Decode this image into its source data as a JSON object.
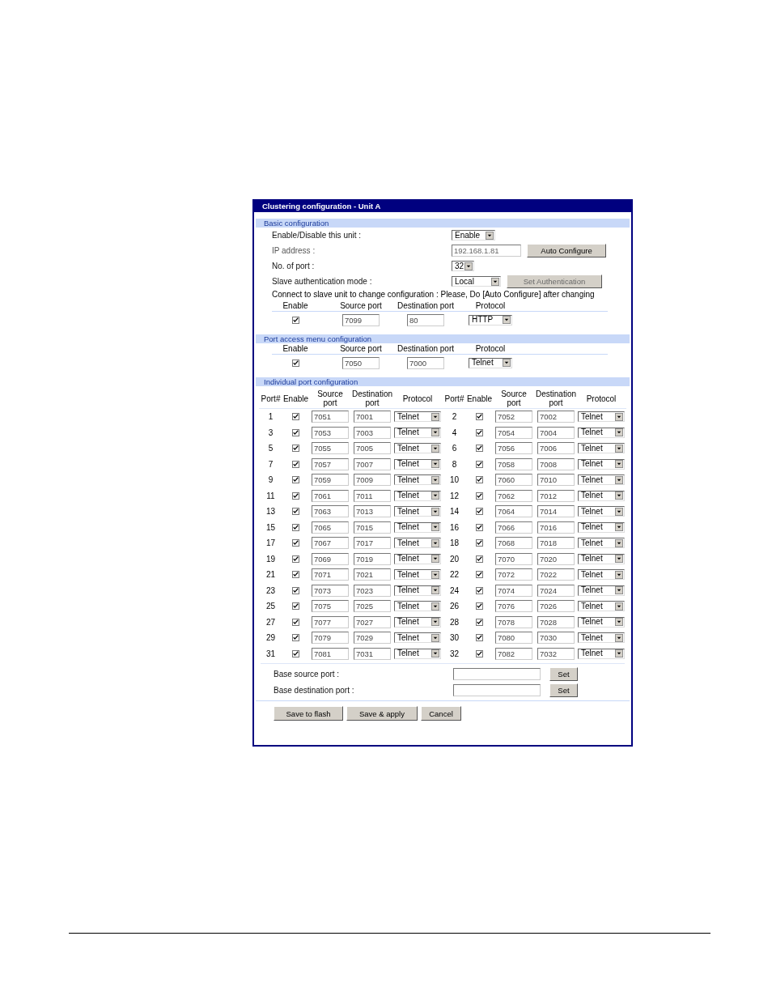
{
  "window": {
    "title": "Clustering configuration - Unit A"
  },
  "basic": {
    "heading": "Basic configuration",
    "fields": [
      {
        "label": "Enable/Disable this unit :",
        "kind": "select",
        "value": "Enable",
        "disabled": false
      },
      {
        "label": "IP address :",
        "kind": "input",
        "value": "192.168.1.81",
        "disabled": true,
        "button": {
          "label": "Auto Configure",
          "disabled": false
        }
      },
      {
        "label": "No. of port :",
        "kind": "select",
        "value": "32",
        "disabled": false
      },
      {
        "label": "Slave authentication mode :",
        "kind": "select",
        "value": "Local",
        "disabled": false,
        "button": {
          "label": "Set Authentication",
          "disabled": true
        }
      }
    ],
    "note": "Connect to slave unit to change configuration : Please, Do [Auto Configure] after changing",
    "columns": [
      "Enable",
      "Source port",
      "Destination port",
      "Protocol"
    ],
    "row": {
      "enabled": true,
      "source": "7099",
      "destination": "80",
      "protocol": "HTTP"
    }
  },
  "port_access": {
    "heading": "Port access menu configuration",
    "columns": [
      "Enable",
      "Source port",
      "Destination port",
      "Protocol"
    ],
    "row": {
      "enabled": true,
      "source": "7050",
      "destination": "7000",
      "protocol": "Telnet"
    }
  },
  "individual": {
    "heading": "Individual port configuration",
    "column_groups": [
      [
        "Port#",
        "Enable",
        "Source port",
        "Destination port",
        "Protocol"
      ],
      [
        "Port#",
        "Enable",
        "Source port",
        "Destination port",
        "Protocol"
      ]
    ],
    "ports": [
      {
        "port": "1",
        "enabled": true,
        "source": "7051",
        "destination": "7001",
        "protocol": "Telnet"
      },
      {
        "port": "2",
        "enabled": true,
        "source": "7052",
        "destination": "7002",
        "protocol": "Telnet"
      },
      {
        "port": "3",
        "enabled": true,
        "source": "7053",
        "destination": "7003",
        "protocol": "Telnet"
      },
      {
        "port": "4",
        "enabled": true,
        "source": "7054",
        "destination": "7004",
        "protocol": "Telnet"
      },
      {
        "port": "5",
        "enabled": true,
        "source": "7055",
        "destination": "7005",
        "protocol": "Telnet"
      },
      {
        "port": "6",
        "enabled": true,
        "source": "7056",
        "destination": "7006",
        "protocol": "Telnet"
      },
      {
        "port": "7",
        "enabled": true,
        "source": "7057",
        "destination": "7007",
        "protocol": "Telnet"
      },
      {
        "port": "8",
        "enabled": true,
        "source": "7058",
        "destination": "7008",
        "protocol": "Telnet"
      },
      {
        "port": "9",
        "enabled": true,
        "source": "7059",
        "destination": "7009",
        "protocol": "Telnet"
      },
      {
        "port": "10",
        "enabled": true,
        "source": "7060",
        "destination": "7010",
        "protocol": "Telnet"
      },
      {
        "port": "11",
        "enabled": true,
        "source": "7061",
        "destination": "7011",
        "protocol": "Telnet"
      },
      {
        "port": "12",
        "enabled": true,
        "source": "7062",
        "destination": "7012",
        "protocol": "Telnet"
      },
      {
        "port": "13",
        "enabled": true,
        "source": "7063",
        "destination": "7013",
        "protocol": "Telnet"
      },
      {
        "port": "14",
        "enabled": true,
        "source": "7064",
        "destination": "7014",
        "protocol": "Telnet"
      },
      {
        "port": "15",
        "enabled": true,
        "source": "7065",
        "destination": "7015",
        "protocol": "Telnet"
      },
      {
        "port": "16",
        "enabled": true,
        "source": "7066",
        "destination": "7016",
        "protocol": "Telnet"
      },
      {
        "port": "17",
        "enabled": true,
        "source": "7067",
        "destination": "7017",
        "protocol": "Telnet"
      },
      {
        "port": "18",
        "enabled": true,
        "source": "7068",
        "destination": "7018",
        "protocol": "Telnet"
      },
      {
        "port": "19",
        "enabled": true,
        "source": "7069",
        "destination": "7019",
        "protocol": "Telnet"
      },
      {
        "port": "20",
        "enabled": true,
        "source": "7070",
        "destination": "7020",
        "protocol": "Telnet"
      },
      {
        "port": "21",
        "enabled": true,
        "source": "7071",
        "destination": "7021",
        "protocol": "Telnet"
      },
      {
        "port": "22",
        "enabled": true,
        "source": "7072",
        "destination": "7022",
        "protocol": "Telnet"
      },
      {
        "port": "23",
        "enabled": true,
        "source": "7073",
        "destination": "7023",
        "protocol": "Telnet"
      },
      {
        "port": "24",
        "enabled": true,
        "source": "7074",
        "destination": "7024",
        "protocol": "Telnet"
      },
      {
        "port": "25",
        "enabled": true,
        "source": "7075",
        "destination": "7025",
        "protocol": "Telnet"
      },
      {
        "port": "26",
        "enabled": true,
        "source": "7076",
        "destination": "7026",
        "protocol": "Telnet"
      },
      {
        "port": "27",
        "enabled": true,
        "source": "7077",
        "destination": "7027",
        "protocol": "Telnet"
      },
      {
        "port": "28",
        "enabled": true,
        "source": "7078",
        "destination": "7028",
        "protocol": "Telnet"
      },
      {
        "port": "29",
        "enabled": true,
        "source": "7079",
        "destination": "7029",
        "protocol": "Telnet"
      },
      {
        "port": "30",
        "enabled": true,
        "source": "7080",
        "destination": "7030",
        "protocol": "Telnet"
      },
      {
        "port": "31",
        "enabled": true,
        "source": "7081",
        "destination": "7031",
        "protocol": "Telnet"
      },
      {
        "port": "32",
        "enabled": true,
        "source": "7082",
        "destination": "7032",
        "protocol": "Telnet"
      }
    ],
    "base_fields": [
      {
        "label": "Base source port :",
        "button": "Set"
      },
      {
        "label": "Base destination port :",
        "button": "Set"
      }
    ]
  },
  "buttons": [
    "Save to flash",
    "Save & apply",
    "Cancel"
  ]
}
